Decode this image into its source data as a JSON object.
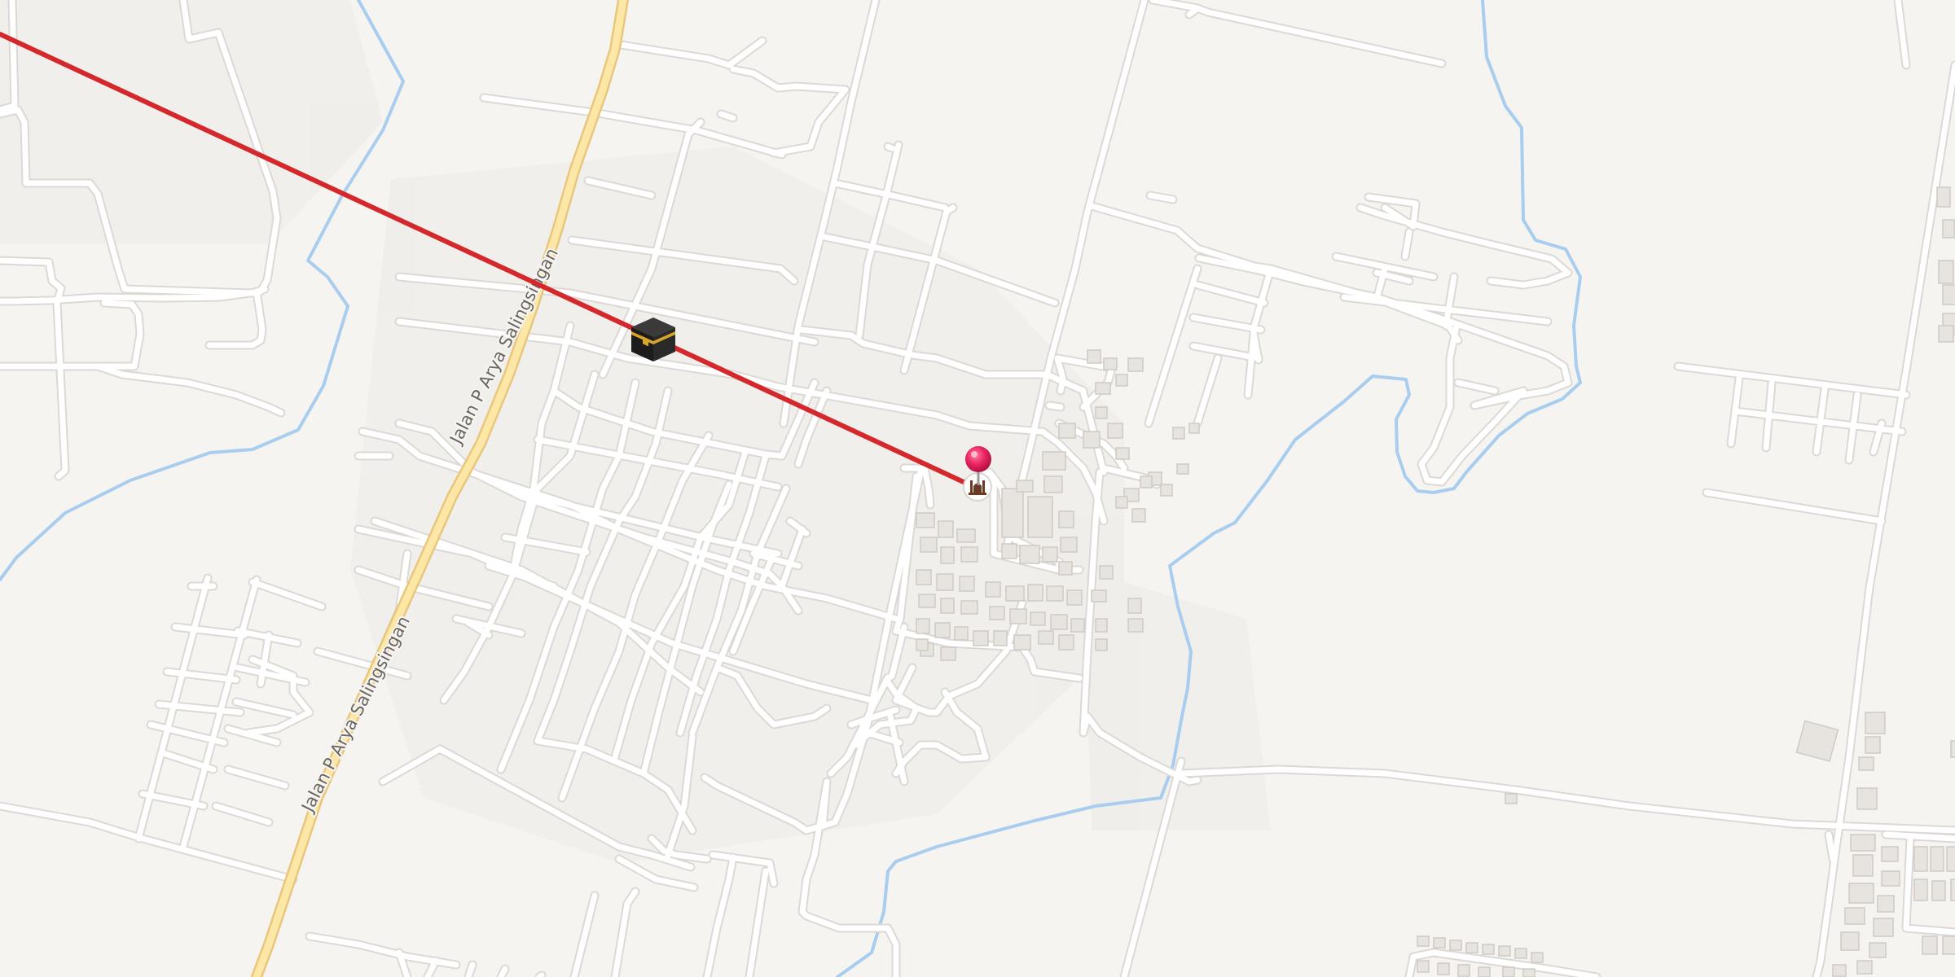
{
  "map": {
    "style": "light street map",
    "colors": {
      "background": "#f6f4f1",
      "land_tint": "#efedea",
      "road": "#ffffff",
      "road_casing": "#dcd9d5",
      "primary_road": "#fde7a6",
      "primary_road_casing": "#e8c77d",
      "river": "#a8cdee",
      "building": "#e7e3df",
      "building_outline": "#cfcac4",
      "qibla_line": "#d4282d",
      "pin": "#e8245f",
      "road_label": "#6a6560"
    }
  },
  "road_labels": [
    {
      "text": "Jalan P Arya Salingsingan",
      "rotation": -63
    },
    {
      "text": "Jalan P Arya Salingsingan",
      "rotation": -63
    }
  ],
  "markers": {
    "kaaba": {
      "icon": "kaaba-icon"
    },
    "location_pin": {
      "icon": "location-pin-icon"
    },
    "mosque": {
      "icon": "mosque-icon"
    }
  },
  "qibla_line": {
    "icon": "qibla-direction-line"
  }
}
